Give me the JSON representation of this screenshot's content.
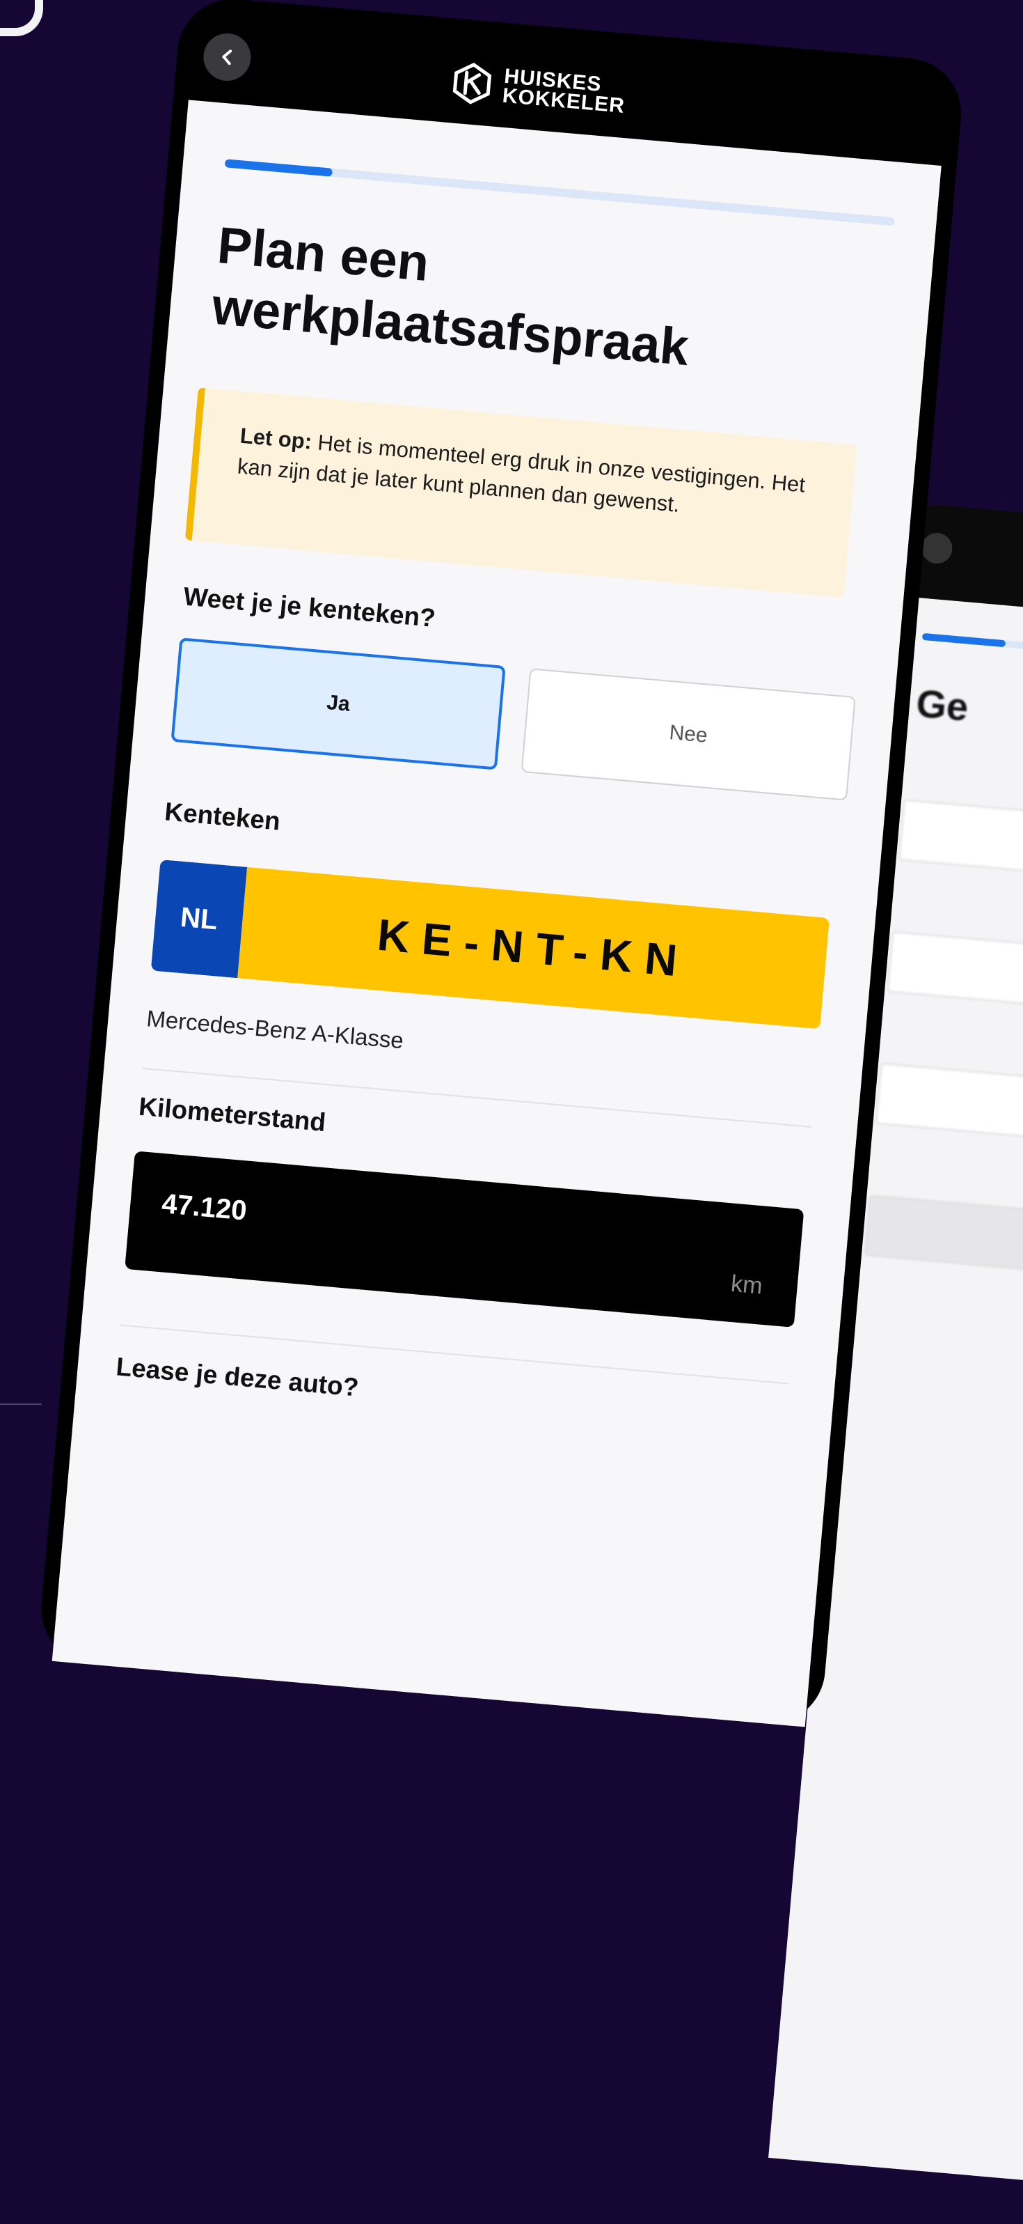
{
  "header": {
    "brand_line1": "HUISKES",
    "brand_line2": "KOKKELER",
    "back_icon": "chevron-left-icon"
  },
  "progress": {
    "value_percent": 16,
    "color": "#1a73e8"
  },
  "page": {
    "title": "Plan een werkplaatsafspraak"
  },
  "notice": {
    "label": "Let op:",
    "text": " Het is momenteel erg druk in onze vestigingen. Het kan zijn dat je later kunt plannen dan gewenst."
  },
  "license_question": {
    "label": "Weet je je kenteken?",
    "options": [
      "Ja",
      "Nee"
    ],
    "selected": "Ja"
  },
  "plate": {
    "label": "Kenteken",
    "country": "NL",
    "number": "KE-NT-KN",
    "car_model": "Mercedes-Benz A-Klasse"
  },
  "mileage": {
    "label": "Kilometerstand",
    "value": "47.120",
    "unit": "km"
  },
  "lease_question": {
    "label": "Lease je deze auto?"
  },
  "colors": {
    "background": "#150634",
    "accent": "#1a73e8",
    "notice_bg": "#fdf2dc",
    "notice_border": "#f5b800",
    "plate_yellow": "#ffc300",
    "plate_blue": "#0b47b4"
  }
}
